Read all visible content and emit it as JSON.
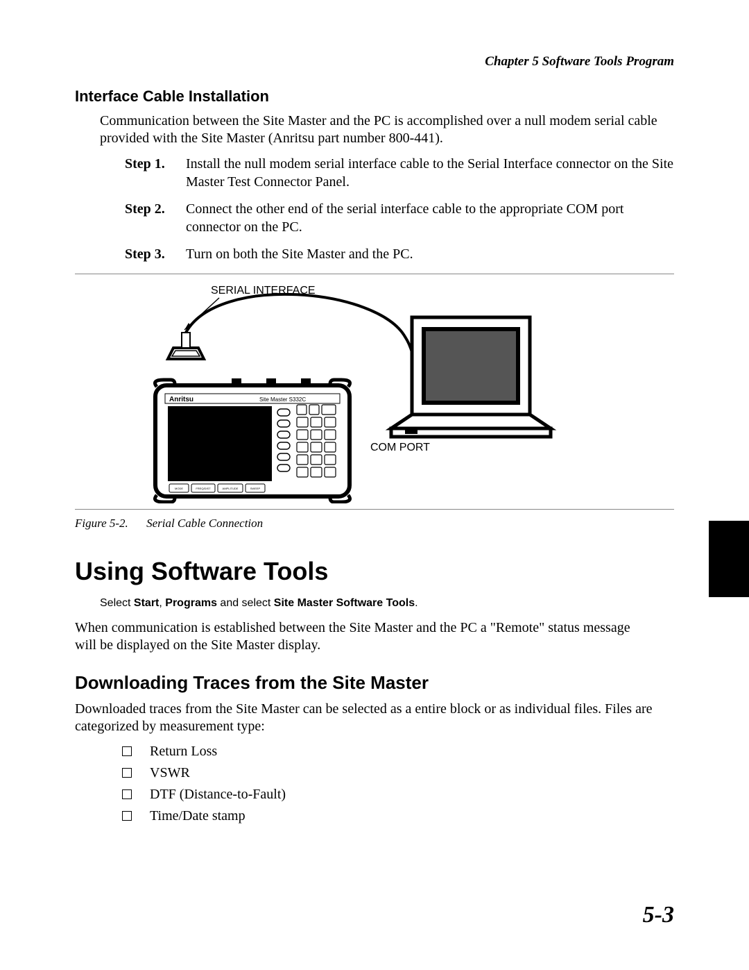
{
  "runningHead": "Chapter 5 Software Tools Program",
  "section1": {
    "title": "Interface Cable Installation",
    "intro": "Communication between the Site Master and the PC is accomplished over a null modem serial cable provided with the Site Master (Anritsu part number 800-441).",
    "steps": [
      {
        "label": "Step 1.",
        "text": "Install the null modem serial interface cable to the Serial Interface connector on the Site Master Test Connector Panel."
      },
      {
        "label": "Step 2.",
        "text": "Connect the other end of the serial interface cable to the appropriate COM port connector on the PC."
      },
      {
        "label": "Step 3.",
        "text": "Turn on both the Site Master and the PC."
      }
    ]
  },
  "figure": {
    "serialLabel": "SERIAL INTERFACE",
    "comLabel": "COM PORT",
    "deviceBrand": "Anritsu",
    "deviceModel": "Site Master S332C",
    "softkeys": [
      "MODE",
      "FREQ/DIST",
      "AMPLITUDE",
      "SWEEP"
    ],
    "captionLabel": "Figure 5-2.",
    "captionText": "Serial Cable Connection"
  },
  "section2": {
    "title": "Using Software Tools",
    "menuPrefix": "Select ",
    "menuStart": "Start",
    "menuMid1": ", ",
    "menuPrograms": "Programs",
    "menuMid2": " and select ",
    "menuApp": "Site Master Software Tools",
    "menuSuffix": ".",
    "para": "When communication is established between the Site Master and the PC a \"Remote\" status message will be displayed on the Site Master display."
  },
  "section3": {
    "title": "Downloading Traces from the Site Master",
    "intro": "Downloaded traces from the Site Master can be selected as a entire block or as individual files. Files are categorized by measurement type:",
    "bullets": [
      "Return Loss",
      "VSWR",
      "DTF (Distance-to-Fault)",
      "Time/Date stamp"
    ]
  },
  "pageNumber": "5-3"
}
